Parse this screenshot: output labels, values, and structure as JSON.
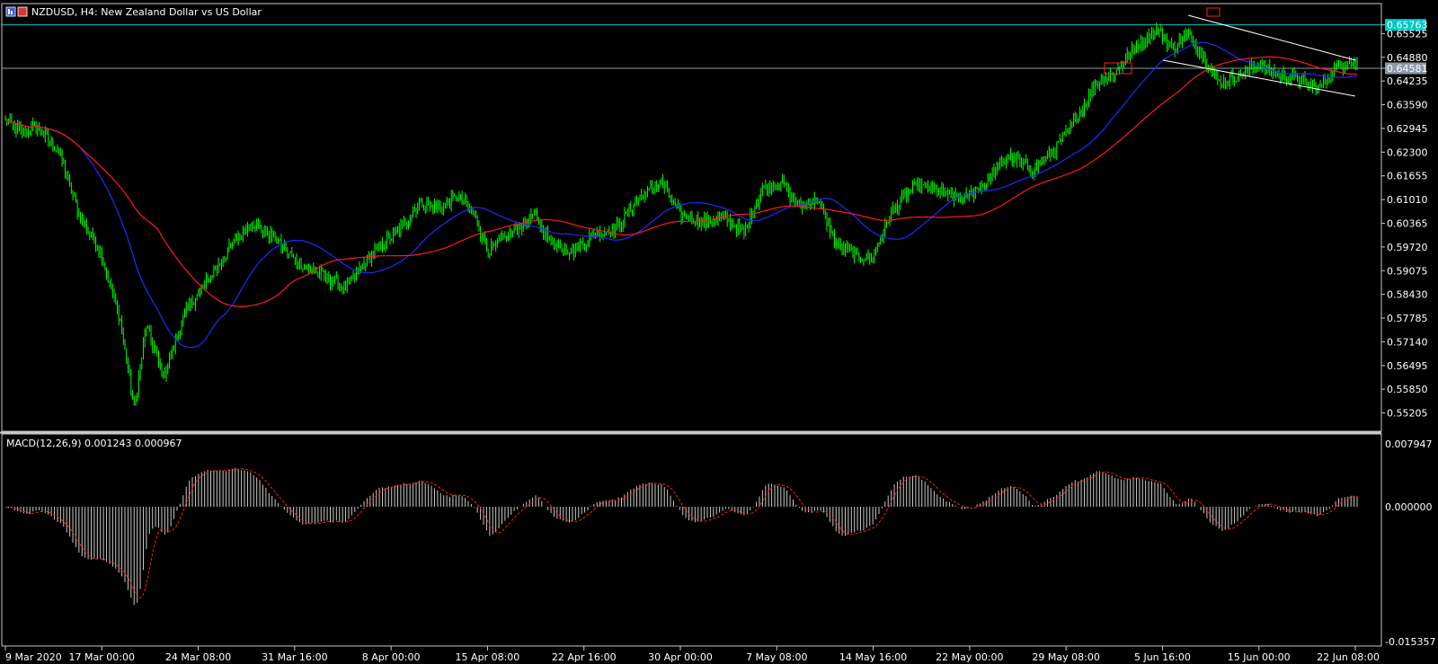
{
  "header": {
    "symbol_title": "NZDUSD, H4:  New Zealand Dollar vs US Dollar",
    "icon": "chart-window-icon"
  },
  "macd": {
    "label": "MACD(12,26,9) 0.001243 0.000967",
    "histogram_color": "#c8c8c8",
    "signal_color": "#ff2020"
  },
  "colors": {
    "background": "#000000",
    "candles": "#00ff00",
    "ma_fast": "#1f2bff",
    "ma_slow": "#ff1a1a",
    "cyan_line": "#00c8c8",
    "gray_line": "#8c9aa6",
    "trendlines": "#ffffff",
    "markers": "#ff2020",
    "frame": "#c8c8c8"
  },
  "price_labels": [
    {
      "value": "0.65763",
      "style": "cyan"
    },
    {
      "value": "0.65525",
      "style": "plain"
    },
    {
      "value": "0.64880",
      "style": "plain"
    },
    {
      "value": "0.64581",
      "style": "gray"
    },
    {
      "value": "0.64235",
      "style": "plain"
    },
    {
      "value": "0.63590",
      "style": "plain"
    },
    {
      "value": "0.62945",
      "style": "plain"
    },
    {
      "value": "0.62300",
      "style": "plain"
    },
    {
      "value": "0.61655",
      "style": "plain"
    },
    {
      "value": "0.61010",
      "style": "plain"
    },
    {
      "value": "0.60365",
      "style": "plain"
    },
    {
      "value": "0.59720",
      "style": "plain"
    },
    {
      "value": "0.59075",
      "style": "plain"
    },
    {
      "value": "0.58430",
      "style": "plain"
    },
    {
      "value": "0.57785",
      "style": "plain"
    },
    {
      "value": "0.57140",
      "style": "plain"
    },
    {
      "value": "0.56495",
      "style": "plain"
    },
    {
      "value": "0.55850",
      "style": "plain"
    },
    {
      "value": "0.55205",
      "style": "plain"
    }
  ],
  "macd_labels": [
    "0.007947",
    "0.000000",
    "-0.015357"
  ],
  "time_labels": [
    "9 Mar 2020",
    "17 Mar 00:00",
    "24 Mar 08:00",
    "31 Mar 16:00",
    "8 Apr 00:00",
    "15 Apr 08:00",
    "22 Apr 16:00",
    "30 Apr 00:00",
    "7 May 08:00",
    "14 May 16:00",
    "22 May 00:00",
    "29 May 08:00",
    "5 Jun 16:00",
    "15 Jun 00:00",
    "22 Jun 08:00"
  ],
  "chart_data": {
    "type": "candlestick",
    "symbol": "NZDUSD",
    "timeframe": "H4",
    "price_range": [
      0.5495,
      0.6595
    ],
    "macd_range": [
      -0.015357,
      0.007947
    ],
    "horizontal_levels": [
      0.65763,
      0.64581
    ],
    "anchors": [
      {
        "t": 0,
        "p": 0.6315
      },
      {
        "t": 10,
        "p": 0.6285
      },
      {
        "t": 20,
        "p": 0.63
      },
      {
        "t": 35,
        "p": 0.623
      },
      {
        "t": 48,
        "p": 0.606
      },
      {
        "t": 62,
        "p": 0.596
      },
      {
        "t": 75,
        "p": 0.577
      },
      {
        "t": 84,
        "p": 0.553
      },
      {
        "t": 92,
        "p": 0.576
      },
      {
        "t": 103,
        "p": 0.562
      },
      {
        "t": 118,
        "p": 0.58
      },
      {
        "t": 132,
        "p": 0.588
      },
      {
        "t": 150,
        "p": 0.599
      },
      {
        "t": 160,
        "p": 0.604
      },
      {
        "t": 175,
        "p": 0.6
      },
      {
        "t": 190,
        "p": 0.593
      },
      {
        "t": 205,
        "p": 0.59
      },
      {
        "t": 222,
        "p": 0.586
      },
      {
        "t": 240,
        "p": 0.596
      },
      {
        "t": 255,
        "p": 0.601
      },
      {
        "t": 270,
        "p": 0.609
      },
      {
        "t": 285,
        "p": 0.608
      },
      {
        "t": 295,
        "p": 0.611
      },
      {
        "t": 305,
        "p": 0.607
      },
      {
        "t": 315,
        "p": 0.596
      },
      {
        "t": 330,
        "p": 0.601
      },
      {
        "t": 345,
        "p": 0.606
      },
      {
        "t": 355,
        "p": 0.599
      },
      {
        "t": 370,
        "p": 0.596
      },
      {
        "t": 385,
        "p": 0.601
      },
      {
        "t": 398,
        "p": 0.602
      },
      {
        "t": 412,
        "p": 0.61
      },
      {
        "t": 428,
        "p": 0.615
      },
      {
        "t": 440,
        "p": 0.606
      },
      {
        "t": 455,
        "p": 0.604
      },
      {
        "t": 470,
        "p": 0.605
      },
      {
        "t": 482,
        "p": 0.601
      },
      {
        "t": 494,
        "p": 0.613
      },
      {
        "t": 506,
        "p": 0.615
      },
      {
        "t": 518,
        "p": 0.608
      },
      {
        "t": 530,
        "p": 0.61
      },
      {
        "t": 542,
        "p": 0.598
      },
      {
        "t": 555,
        "p": 0.595
      },
      {
        "t": 565,
        "p": 0.594
      },
      {
        "t": 580,
        "p": 0.608
      },
      {
        "t": 595,
        "p": 0.614
      },
      {
        "t": 610,
        "p": 0.612
      },
      {
        "t": 625,
        "p": 0.61
      },
      {
        "t": 640,
        "p": 0.615
      },
      {
        "t": 655,
        "p": 0.622
      },
      {
        "t": 670,
        "p": 0.618
      },
      {
        "t": 685,
        "p": 0.624
      },
      {
        "t": 700,
        "p": 0.633
      },
      {
        "t": 712,
        "p": 0.642
      },
      {
        "t": 725,
        "p": 0.645
      },
      {
        "t": 738,
        "p": 0.652
      },
      {
        "t": 752,
        "p": 0.656
      },
      {
        "t": 762,
        "p": 0.651
      },
      {
        "t": 772,
        "p": 0.6555
      },
      {
        "t": 782,
        "p": 0.649
      },
      {
        "t": 792,
        "p": 0.642
      },
      {
        "t": 805,
        "p": 0.644
      },
      {
        "t": 818,
        "p": 0.647
      },
      {
        "t": 830,
        "p": 0.644
      },
      {
        "t": 843,
        "p": 0.643
      },
      {
        "t": 856,
        "p": 0.64
      },
      {
        "t": 866,
        "p": 0.645
      },
      {
        "t": 876,
        "p": 0.648
      },
      {
        "t": 882,
        "p": 0.647
      }
    ],
    "total_bars": 883
  }
}
